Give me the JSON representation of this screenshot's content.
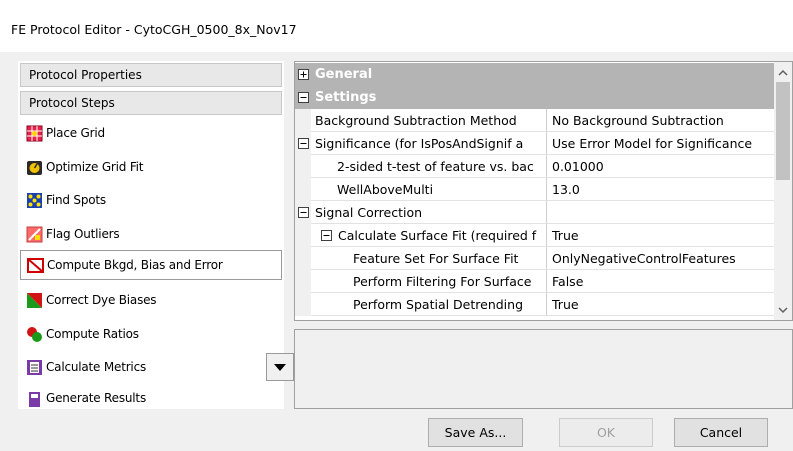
{
  "window": {
    "title": "FE Protocol Editor - CytoCGH_0500_8x_Nov17"
  },
  "left_panel": {
    "protocol_properties_label": "Protocol Properties",
    "protocol_steps_label": "Protocol Steps",
    "steps": [
      {
        "label": "Place Grid",
        "icon": "place-grid-icon"
      },
      {
        "label": "Optimize Grid Fit",
        "icon": "optimize-grid-fit-icon"
      },
      {
        "label": "Find Spots",
        "icon": "find-spots-icon"
      },
      {
        "label": "Flag Outliers",
        "icon": "flag-outliers-icon"
      },
      {
        "label": "Compute Bkgd, Bias and Error",
        "icon": "compute-bkgd-icon",
        "selected": true
      },
      {
        "label": "Correct Dye Biases",
        "icon": "correct-dye-biases-icon"
      },
      {
        "label": "Compute Ratios",
        "icon": "compute-ratios-icon"
      },
      {
        "label": "Calculate Metrics",
        "icon": "calculate-metrics-icon"
      },
      {
        "label": "Generate Results",
        "icon": "generate-results-icon"
      }
    ]
  },
  "property_grid": {
    "categories": {
      "general": {
        "label": "General",
        "toggle": "+"
      },
      "settings": {
        "label": "Settings",
        "toggle": "-"
      }
    },
    "rows": [
      {
        "name": "Background Subtraction Method",
        "value": "No Background Subtraction"
      },
      {
        "name": "Significance (for IsPosAndSignif a",
        "value": "Use Error Model for Significance"
      },
      {
        "name": "2-sided t-test of feature vs. bac",
        "value": "0.01000"
      },
      {
        "name": "WellAboveMulti",
        "value": "13.0"
      },
      {
        "name": "Signal Correction",
        "value": ""
      },
      {
        "name": "Calculate Surface Fit (required f",
        "value": "True"
      },
      {
        "name": "Feature Set For Surface Fit",
        "value": "OnlyNegativeControlFeatures"
      },
      {
        "name": "Perform Filtering For Surface",
        "value": "False"
      },
      {
        "name": "Perform Spatial Detrending",
        "value": "True"
      }
    ]
  },
  "buttons": {
    "save_as": "Save As...",
    "ok": "OK",
    "cancel": "Cancel"
  },
  "colors": {
    "category_bg": "#b4b4b4",
    "window_bg": "#f0f0f0",
    "selected_border": "#9a9a9a"
  }
}
